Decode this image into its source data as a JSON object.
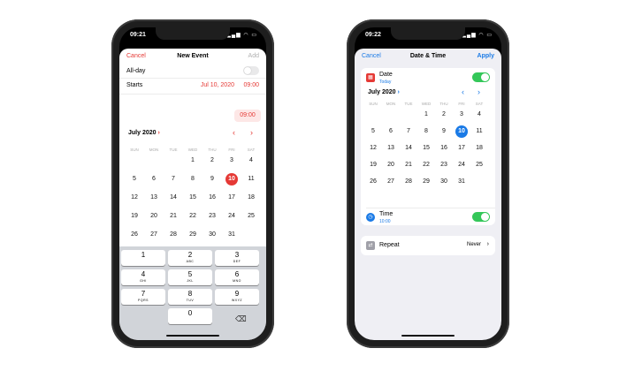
{
  "left_phone": {
    "status_time": "09:21",
    "status_icons": "▂▄▆ ◠ ▭",
    "nav": {
      "cancel": "Cancel",
      "title": "New Event",
      "add": "Add"
    },
    "allday_label": "All-day",
    "starts": {
      "label": "Starts",
      "date": "Jul 10, 2020",
      "time": "09:00"
    },
    "time_pill": "09:00",
    "month_label": "July 2020",
    "month_chevron": "›",
    "prev_arrow": "‹",
    "next_arrow": "›",
    "weekdays": [
      "SUN",
      "MON",
      "TUE",
      "WED",
      "THU",
      "FRI",
      "SAT"
    ],
    "selected_day": "10",
    "keypad": [
      {
        "n": "1",
        "s": ""
      },
      {
        "n": "2",
        "s": "ABC"
      },
      {
        "n": "3",
        "s": "DEF"
      },
      {
        "n": "4",
        "s": "GHI"
      },
      {
        "n": "5",
        "s": "JKL"
      },
      {
        "n": "6",
        "s": "MNO"
      },
      {
        "n": "7",
        "s": "PQRS"
      },
      {
        "n": "8",
        "s": "TUV"
      },
      {
        "n": "9",
        "s": "WXYZ"
      },
      {
        "n": "0",
        "s": ""
      }
    ],
    "backspace": "⌫"
  },
  "right_phone": {
    "status_time": "09:22",
    "status_icons": "▂▄▆ ◠ ▭",
    "nav": {
      "cancel": "Cancel",
      "title": "Date & Time",
      "apply": "Apply"
    },
    "date_label": "Date",
    "date_sub": "Today",
    "month_label": "July 2020",
    "month_chevron": "›",
    "prev_arrow": "‹",
    "next_arrow": "›",
    "weekdays": [
      "SUN",
      "MON",
      "TUE",
      "WED",
      "THU",
      "FRI",
      "SAT"
    ],
    "selected_day": "10",
    "time_label": "Time",
    "time_sub": "10:00",
    "repeat_label": "Repeat",
    "repeat_value": "Never",
    "repeat_chevron": "›"
  },
  "calendar_days": [
    [
      "",
      "",
      "",
      "1",
      "2",
      "3",
      "4"
    ],
    [
      "5",
      "6",
      "7",
      "8",
      "9",
      "10",
      "11"
    ],
    [
      "12",
      "13",
      "14",
      "15",
      "16",
      "17",
      "18"
    ],
    [
      "19",
      "20",
      "21",
      "22",
      "23",
      "24",
      "25"
    ],
    [
      "26",
      "27",
      "28",
      "29",
      "30",
      "31",
      ""
    ]
  ],
  "colors": {
    "accent_red": "#e53935",
    "accent_blue": "#1a7ae6",
    "toggle_green": "#34c759"
  }
}
